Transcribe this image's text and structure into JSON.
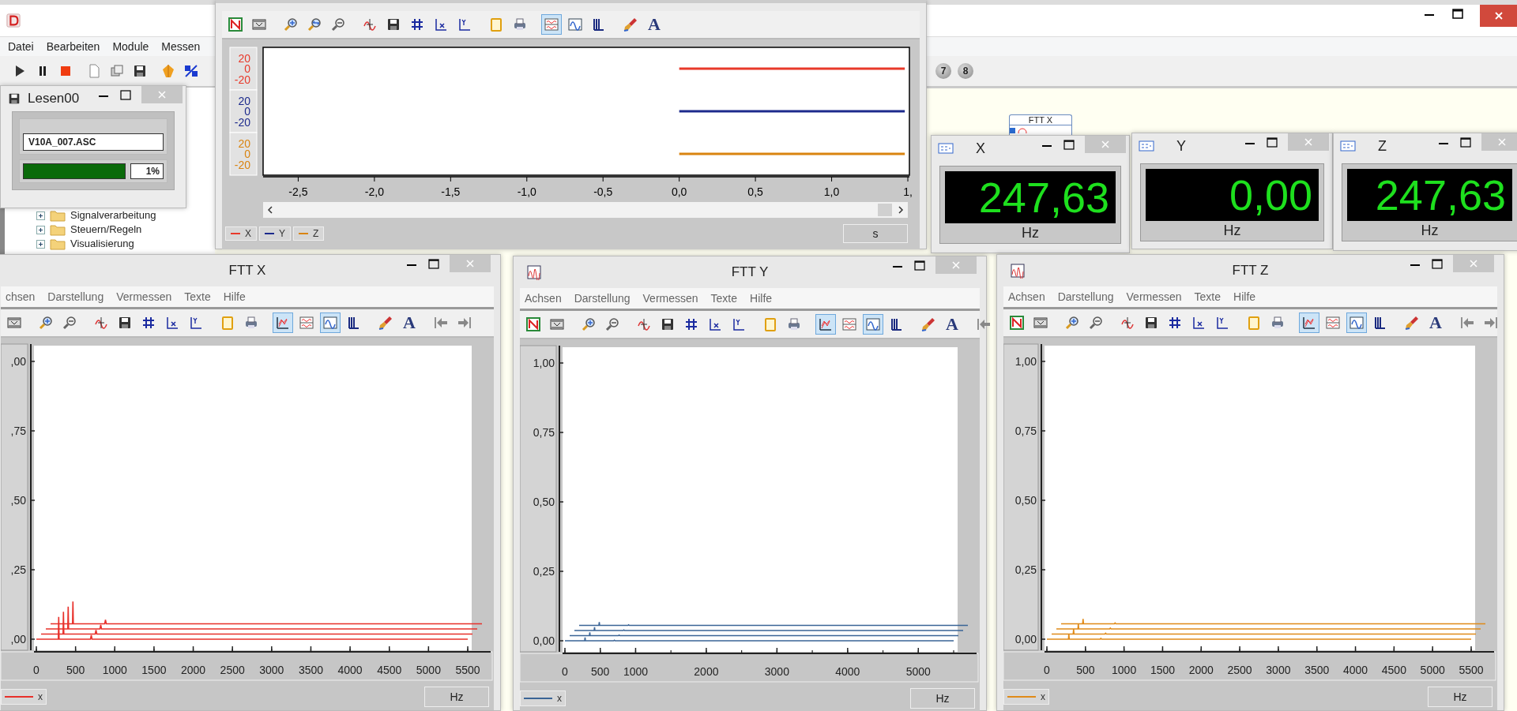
{
  "app": {
    "menu": [
      {
        "label": "Datei"
      },
      {
        "label": "Bearbeiten"
      },
      {
        "label": "Module"
      },
      {
        "label": "Messen"
      }
    ],
    "toolbar": [
      {
        "kind": "play"
      },
      {
        "kind": "pause"
      },
      {
        "kind": "stop"
      },
      {
        "kind": "document"
      },
      {
        "kind": "copy"
      },
      {
        "kind": "save"
      },
      {
        "kind": "module"
      },
      {
        "kind": "converter"
      }
    ],
    "step_buttons": [
      {
        "label": "7"
      },
      {
        "label": "8"
      }
    ],
    "tree": [
      {
        "label": "Signalverarbeitung"
      },
      {
        "label": "Steuern/Regeln"
      },
      {
        "label": "Visualisierung"
      }
    ],
    "canvas_block": {
      "title": "FTT X"
    }
  },
  "reader_window": {
    "title": "Lesen00",
    "file": "V10A_007.ASC",
    "progress": {
      "level": 1,
      "reading": "1%"
    }
  },
  "scope_window": {
    "toolbar": [
      {
        "kind": "chart",
        "selected": false
      },
      {
        "kind": "film",
        "selected": false
      },
      {
        "kind": "zoom-in",
        "selected": false
      },
      {
        "kind": "zoom-fit",
        "selected": false
      },
      {
        "kind": "zoom-out",
        "selected": false
      },
      {
        "kind": "cursor",
        "selected": false
      },
      {
        "kind": "save",
        "selected": false
      },
      {
        "kind": "grid",
        "selected": false
      },
      {
        "kind": "x-axis",
        "selected": false
      },
      {
        "kind": "y-axis",
        "selected": false
      },
      {
        "kind": "clipboard",
        "selected": false
      },
      {
        "kind": "printer",
        "selected": false
      },
      {
        "kind": "stacked",
        "selected": true
      },
      {
        "kind": "wave",
        "selected": false
      },
      {
        "kind": "bars",
        "selected": false
      },
      {
        "kind": "brush",
        "selected": false
      },
      {
        "kind": "text",
        "label": "A",
        "selected": false
      }
    ],
    "x_labels": [
      "-2,5",
      "-2,0",
      "-1,5",
      "-1,0",
      "-0,5",
      "0,0",
      "0,5",
      "1,0",
      "1,"
    ],
    "channels": [
      {
        "name": "X",
        "color": "#e8392a",
        "scale": [
          "20",
          "0",
          "-20"
        ]
      },
      {
        "name": "Y",
        "color": "#1c2a8c",
        "scale": [
          "20",
          "0",
          "-20"
        ]
      },
      {
        "name": "Z",
        "color": "#d98410",
        "scale": [
          "20",
          "0",
          "-20"
        ]
      }
    ],
    "unit": "s"
  },
  "meters": [
    {
      "title": "X",
      "value": "247,63",
      "unit": "Hz"
    },
    {
      "title": "Y",
      "value": "0,00",
      "unit": "Hz"
    },
    {
      "title": "Z",
      "value": "247,63",
      "unit": "Hz"
    }
  ],
  "fft_windows": [
    {
      "title": "FTT X",
      "title_icon": false,
      "menu": [
        "chsen",
        "Darstellung",
        "Vermessen",
        "Texte",
        "Hilfe"
      ],
      "toolbar": [
        {
          "kind": "film",
          "selected": false
        },
        {
          "kind": "zoom-in",
          "selected": false
        },
        {
          "kind": "zoom-out",
          "selected": false
        },
        {
          "kind": "cursor",
          "selected": false
        },
        {
          "kind": "save",
          "selected": false
        },
        {
          "kind": "grid",
          "selected": false
        },
        {
          "kind": "x-axis",
          "selected": false
        },
        {
          "kind": "y-axis",
          "selected": false
        },
        {
          "kind": "clipboard",
          "selected": false
        },
        {
          "kind": "printer",
          "selected": false
        },
        {
          "kind": "waterfall",
          "selected": true
        },
        {
          "kind": "stacked",
          "selected": false
        },
        {
          "kind": "wave",
          "selected": true
        },
        {
          "kind": "bars",
          "selected": false
        },
        {
          "kind": "brush",
          "selected": false
        },
        {
          "kind": "text",
          "label": "A",
          "selected": false
        },
        {
          "kind": "arrow-left",
          "selected": false
        },
        {
          "kind": "arrow-right",
          "selected": false
        }
      ],
      "color": "#e8302a",
      "y_labels": [
        ",00",
        ",75",
        ",50",
        ",25",
        ",00"
      ],
      "x_labels": [
        "0",
        "500",
        "1000",
        "1500",
        "2000",
        "2500",
        "3000",
        "3500",
        "4000",
        "4500",
        "5000",
        "5500"
      ],
      "legend": "x",
      "unit": "Hz"
    },
    {
      "title": "FTT Y",
      "title_icon": true,
      "menu": [
        "Achsen",
        "Darstellung",
        "Vermessen",
        "Texte",
        "Hilfe"
      ],
      "toolbar": [
        {
          "kind": "chart",
          "selected": false
        },
        {
          "kind": "film",
          "selected": false
        },
        {
          "kind": "zoom-in",
          "selected": false
        },
        {
          "kind": "zoom-out",
          "selected": false
        },
        {
          "kind": "cursor",
          "selected": false
        },
        {
          "kind": "save",
          "selected": false
        },
        {
          "kind": "grid",
          "selected": false
        },
        {
          "kind": "x-axis",
          "selected": false
        },
        {
          "kind": "y-axis",
          "selected": false
        },
        {
          "kind": "clipboard",
          "selected": false
        },
        {
          "kind": "printer",
          "selected": false
        },
        {
          "kind": "waterfall",
          "selected": true
        },
        {
          "kind": "stacked",
          "selected": false
        },
        {
          "kind": "wave",
          "selected": true
        },
        {
          "kind": "bars",
          "selected": false
        },
        {
          "kind": "brush",
          "selected": false
        },
        {
          "kind": "text",
          "label": "A",
          "selected": false
        },
        {
          "kind": "arrow-left",
          "selected": false
        }
      ],
      "color": "#3a6496",
      "y_labels": [
        "1,00",
        "0,75",
        "0,50",
        "0,25",
        "0,00"
      ],
      "x_labels": [
        "0",
        "500",
        "1000",
        "2000",
        "3000",
        "4000",
        "5000"
      ],
      "legend": "x",
      "unit": "Hz"
    },
    {
      "title": "FTT Z",
      "title_icon": true,
      "menu": [
        "Achsen",
        "Darstellung",
        "Vermessen",
        "Texte",
        "Hilfe"
      ],
      "toolbar": [
        {
          "kind": "chart",
          "selected": false
        },
        {
          "kind": "film",
          "selected": false
        },
        {
          "kind": "zoom-in",
          "selected": false
        },
        {
          "kind": "zoom-out",
          "selected": false
        },
        {
          "kind": "cursor",
          "selected": false
        },
        {
          "kind": "save",
          "selected": false
        },
        {
          "kind": "grid",
          "selected": false
        },
        {
          "kind": "x-axis",
          "selected": false
        },
        {
          "kind": "y-axis",
          "selected": false
        },
        {
          "kind": "clipboard",
          "selected": false
        },
        {
          "kind": "printer",
          "selected": false
        },
        {
          "kind": "waterfall",
          "selected": true
        },
        {
          "kind": "stacked",
          "selected": false
        },
        {
          "kind": "wave",
          "selected": true
        },
        {
          "kind": "bars",
          "selected": false
        },
        {
          "kind": "brush",
          "selected": false
        },
        {
          "kind": "text",
          "label": "A",
          "selected": false
        },
        {
          "kind": "arrow-left",
          "selected": false
        },
        {
          "kind": "arrow-right",
          "selected": false
        }
      ],
      "color": "#e08a18",
      "y_labels": [
        "1,00",
        "0,75",
        "0,50",
        "0,25",
        "0,00"
      ],
      "x_labels": [
        "0",
        "500",
        "1000",
        "1500",
        "2000",
        "2500",
        "3000",
        "3500",
        "4000",
        "4500",
        "5000",
        "5500"
      ],
      "legend": "x",
      "unit": "Hz"
    }
  ]
}
